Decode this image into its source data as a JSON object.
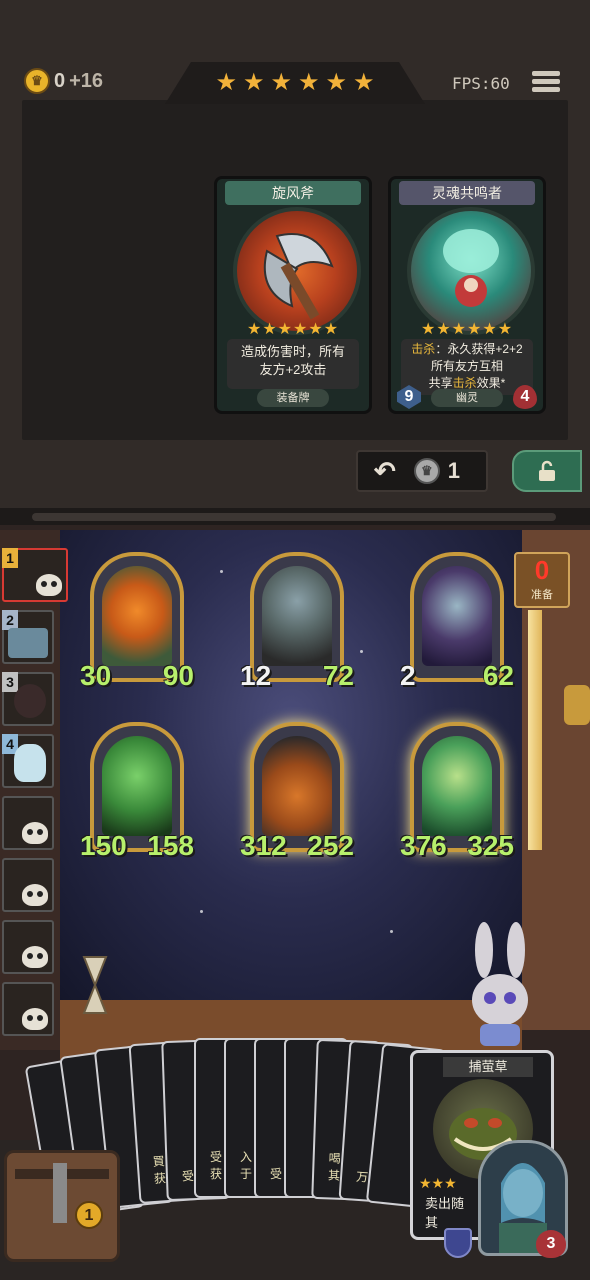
{
  "hud": {
    "gold_amount": "0",
    "gold_income": "+16",
    "tier_stars": 6,
    "fps_label": "FPS:60"
  },
  "shop": {
    "cards": [
      {
        "title": "旋风斧",
        "stars": 6,
        "desc_line1": "造成伤害时，所有",
        "desc_line2": "友方+2攻击",
        "type": "装备牌"
      },
      {
        "title": "灵魂共鸣者",
        "stars": 6,
        "desc_prefix": "击杀",
        "desc_line1_rest": "：永久获得+2+2",
        "desc_line2": "所有友方互相",
        "desc_line3_pre": "共享",
        "desc_line3_hl": "击杀",
        "desc_line3_post": "效果*",
        "type": "幽灵",
        "attack": "9",
        "health": "4"
      }
    ],
    "refresh_cost": "1"
  },
  "enemies": [
    {
      "num": "1",
      "num_color": "#e8b13a",
      "active": true
    },
    {
      "num": "2",
      "num_color": "#a6b4c8"
    },
    {
      "num": "3",
      "num_color": "#c0c0c0"
    },
    {
      "num": "4",
      "num_color": "#8fb8d8"
    },
    {
      "num": ""
    },
    {
      "num": ""
    },
    {
      "num": ""
    },
    {
      "num": ""
    }
  ],
  "ready": {
    "count": "0",
    "label": "准备"
  },
  "board": {
    "minions": [
      {
        "attack": "30",
        "health": "90",
        "art": "pumpkin-witch"
      },
      {
        "attack": "12",
        "health": "72",
        "art": "mushroom-spider"
      },
      {
        "attack": "2",
        "health": "62",
        "art": "vampire-elf"
      },
      {
        "attack": "150",
        "health": "158",
        "art": "dryad"
      },
      {
        "attack": "312",
        "health": "252",
        "art": "pumpkin-duo"
      },
      {
        "attack": "376",
        "health": "325",
        "art": "forest-fairy"
      }
    ]
  },
  "hand": {
    "small_card_texts": [
      "",
      "",
      "",
      "",
      "",
      "",
      "",
      "",
      "",
      "",
      "",
      ""
    ],
    "snippets": [
      "買\n获",
      "受",
      "受\n获",
      "入\n于",
      "受",
      "",
      "喝\n其",
      "万",
      "",
      "",
      "",
      ""
    ],
    "top_card": {
      "title": "捕萤草",
      "stars": 3,
      "desc": "卖出随\n其"
    }
  },
  "chest": {
    "count": "1"
  },
  "hero": {
    "health": "3"
  },
  "colors": {
    "gold": "#e9b42a",
    "star": "#f2b23a",
    "attack_text": "#b7f06c",
    "ready_red": "#ff3a2a",
    "frame_gold": "#c89a3c"
  }
}
